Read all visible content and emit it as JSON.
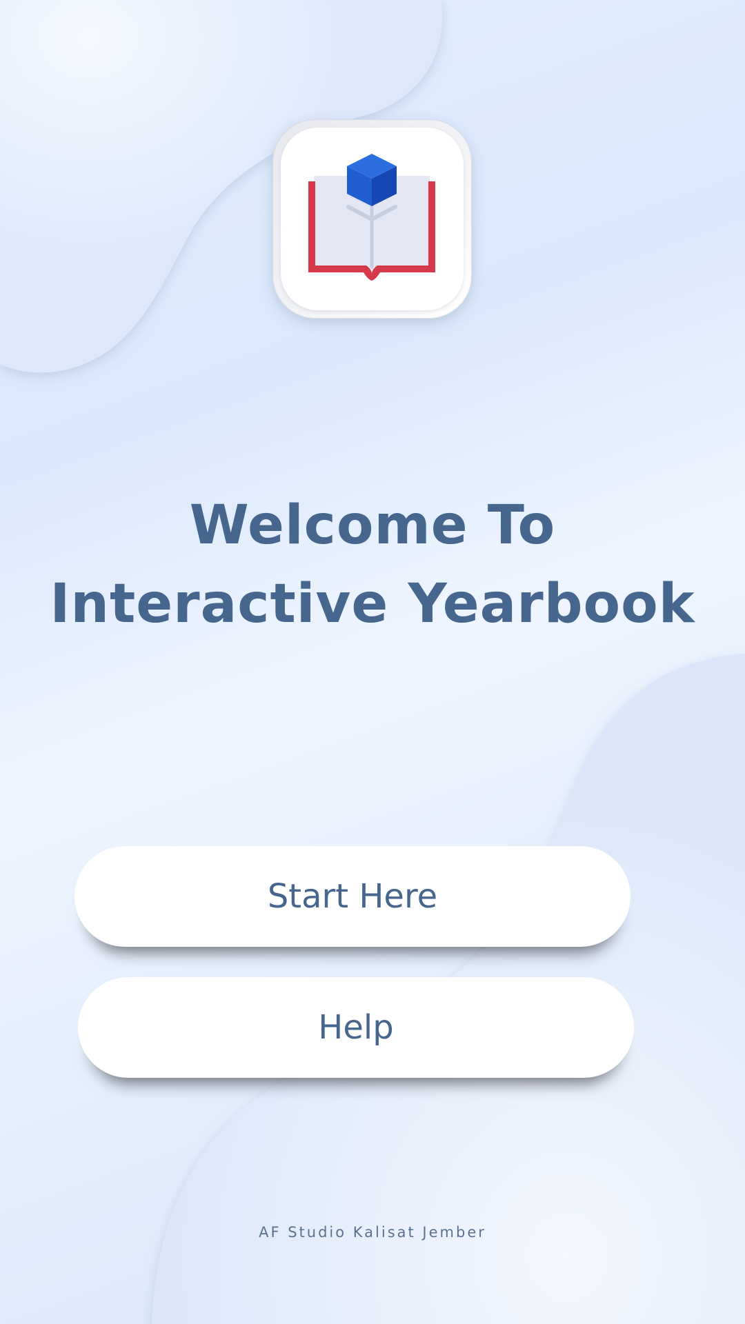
{
  "app_icon": {
    "name": "book-cube-icon",
    "colors": {
      "book_cover": "#d63a4a",
      "book_pages": "#e3e6f3",
      "cube_top": "#2a6ee0",
      "cube_left": "#1f5fd1",
      "cube_right": "#1646b3"
    }
  },
  "welcome": {
    "line1": "Welcome To",
    "line2": "Interactive Yearbook"
  },
  "buttons": {
    "start_label": "Start Here",
    "help_label": "Help"
  },
  "footer": {
    "credit": "AF Studio Kalisat Jember"
  },
  "theme": {
    "text_color": "#46668e",
    "button_bg": "#ffffff"
  }
}
